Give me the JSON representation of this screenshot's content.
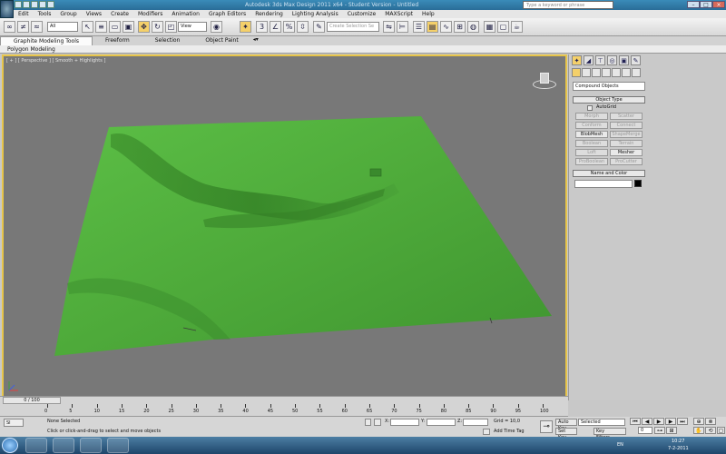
{
  "window": {
    "title": "Autodesk 3ds Max Design 2011 x64 - Student Version - Untitled",
    "search_placeholder": "Type a keyword or phrase",
    "minimize": "–",
    "maximize": "□",
    "close": "×"
  },
  "menu": {
    "items": [
      "Edit",
      "Tools",
      "Group",
      "Views",
      "Create",
      "Modifiers",
      "Animation",
      "Graph Editors",
      "Rendering",
      "Lighting Analysis",
      "Customize",
      "MAXScript",
      "Help"
    ]
  },
  "toolbar": {
    "selection_filter": "All",
    "reference_coord": "View",
    "named_selection_placeholder": "Create Selection Se"
  },
  "ribbon": {
    "tabs": [
      "Graphite Modeling Tools",
      "Freeform",
      "Selection",
      "Object Paint"
    ],
    "sub_label": "Polygon Modeling"
  },
  "viewport": {
    "label": "[ + ] [ Perspective ] [ Smooth + Highlights ]",
    "terrain_color": "#4eaa3a",
    "background_color": "#787878",
    "active_border_color": "#e7c54a"
  },
  "command_panel": {
    "category_dropdown": "Compound Objects",
    "object_type_header": "Object Type",
    "autogrid_label": "AutoGrid",
    "buttons": [
      {
        "label": "Morph",
        "enabled": false
      },
      {
        "label": "Scatter",
        "enabled": false
      },
      {
        "label": "Conform",
        "enabled": false
      },
      {
        "label": "Connect",
        "enabled": false
      },
      {
        "label": "BlobMesh",
        "enabled": true
      },
      {
        "label": "ShapeMerge",
        "enabled": false
      },
      {
        "label": "Boolean",
        "enabled": false
      },
      {
        "label": "Terrain",
        "enabled": false
      },
      {
        "label": "Loft",
        "enabled": false
      },
      {
        "label": "Mesher",
        "enabled": true
      },
      {
        "label": "ProBoolean",
        "enabled": false
      },
      {
        "label": "ProCutter",
        "enabled": false
      }
    ],
    "name_color_header": "Name and Color",
    "object_color": "#000000"
  },
  "timeline": {
    "slider_label": "0 / 100",
    "ticks": [
      "0",
      "5",
      "10",
      "15",
      "20",
      "25",
      "30",
      "35",
      "40",
      "45",
      "50",
      "55",
      "60",
      "65",
      "70",
      "75",
      "80",
      "85",
      "90",
      "95",
      "100"
    ]
  },
  "status": {
    "selection_state": "None Selected",
    "prompt": "Click or click-and-drag to select and move objects",
    "x_label": "X:",
    "y_label": "Y:",
    "z_label": "Z:",
    "grid": "Grid = 10,0",
    "add_time_tag": "Add Time Tag",
    "auto_key": "Auto Key",
    "set_key": "Set Key",
    "key_mode_value": "Selected",
    "key_filters": "Key Filters...",
    "frame": "0",
    "minimize_label": "Sl"
  },
  "taskbar": {
    "language": "EN",
    "time": "10:27",
    "date": "7-2-2011"
  }
}
